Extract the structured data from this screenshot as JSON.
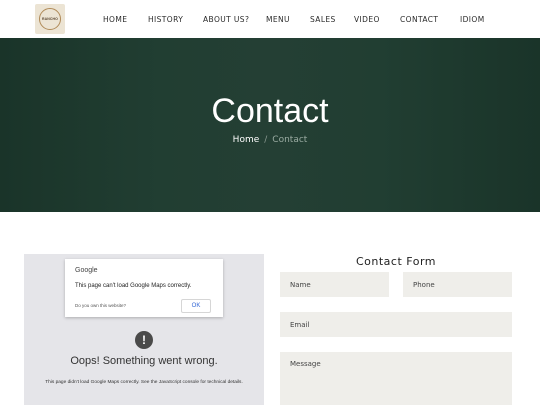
{
  "header": {
    "logo_text": "RANCHO",
    "nav": [
      "HOME",
      "HISTORY",
      "ABOUT US?",
      "MENU",
      "SALES",
      "VIDEO",
      "CONTACT",
      "IDIOM"
    ]
  },
  "hero": {
    "title": "Contact",
    "breadcrumb_home": "Home",
    "breadcrumb_sep": "/",
    "breadcrumb_current": "Contact"
  },
  "map": {
    "brand": "Google",
    "message": "This page can't load Google Maps correctly.",
    "own_site_link": "Do you own this website?",
    "ok_label": "OK",
    "warning_glyph": "!",
    "error_title": "Oops! Something went wrong.",
    "error_detail": "This page didn't load Google Maps correctly. See the JavaScript console for technical details."
  },
  "form": {
    "title": "Contact Form",
    "name_placeholder": "Name",
    "phone_placeholder": "Phone",
    "email_placeholder": "Email",
    "message_placeholder": "Message"
  }
}
